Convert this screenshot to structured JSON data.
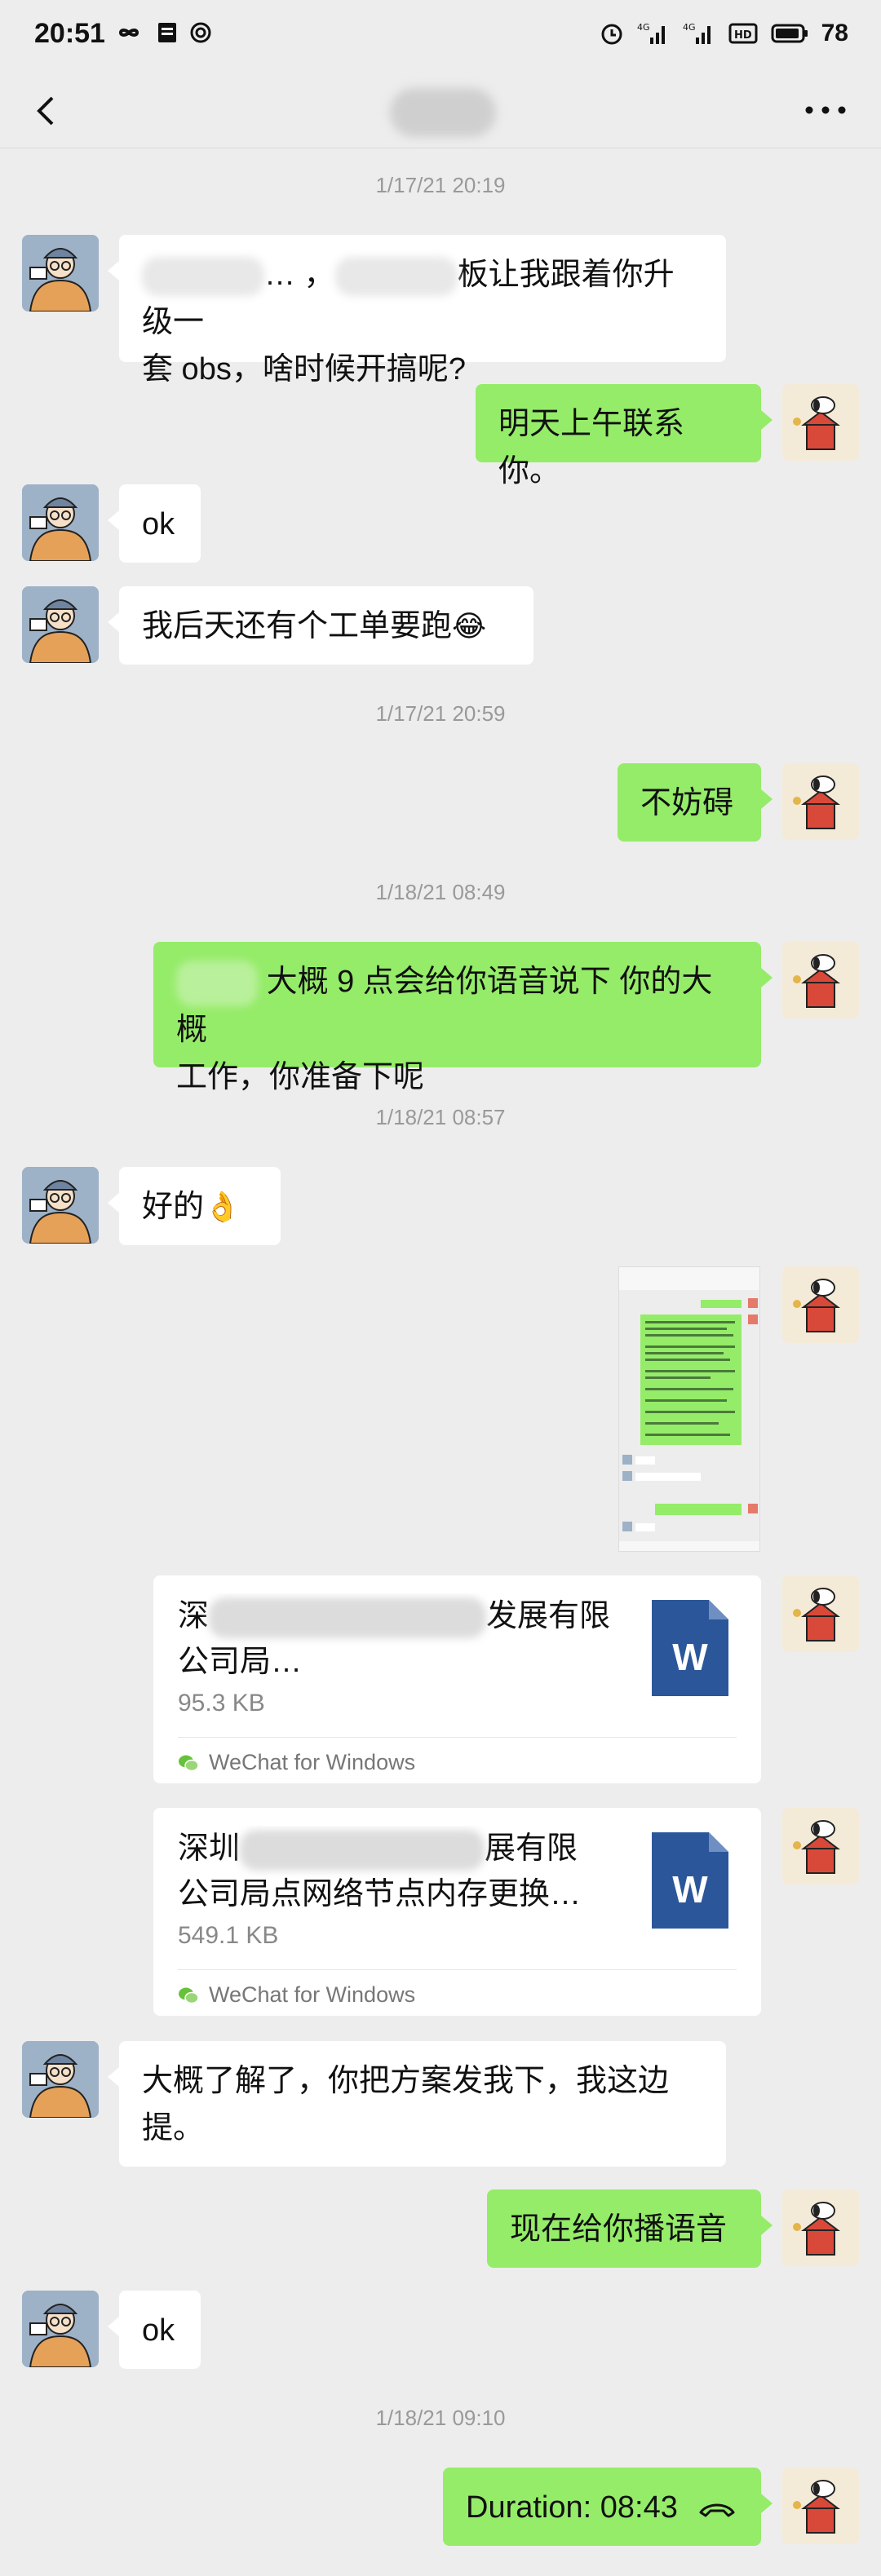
{
  "status_bar": {
    "time": "20:51",
    "battery": "78",
    "signal_label_1": "4G",
    "signal_label_2": "4G",
    "hd_label": "HD"
  },
  "chat": {
    "title": "",
    "timestamps": [
      "1/17/21 20:19",
      "1/17/21 20:59",
      "1/18/21 08:49",
      "1/18/21 08:57",
      "1/18/21 09:10"
    ],
    "messages": {
      "m1_a": "… ，",
      "m1_b": "板让我跟着你升级一",
      "m1_c": "套 obs，啥时候开搞呢?",
      "m2": "明天上午联系你。",
      "m3": "ok",
      "m4": "我后天还有个工单要跑",
      "m4_emoji": "😂",
      "m5": "不妨碍",
      "m6_a": "大概 9 点会给你语音说下 你的大概",
      "m6_b": "工作，你准备下呢",
      "m7": "好的",
      "m7_emoji": "👌",
      "m10_a": "大概了解了，你把方案发我下，我这边",
      "m10_b": "提。",
      "m11": "现在给你播语音",
      "m12": "ok",
      "m13": "Duration: 08:43"
    },
    "files": [
      {
        "name_a": "深",
        "name_b": "发展有限",
        "name_c": "公司局…",
        "size": "95.3 KB",
        "source": "WeChat for Windows",
        "icon_letter": "W"
      },
      {
        "name_a": "深圳",
        "name_b": "展有限",
        "name_c": "公司局点网络节点内存更换…",
        "size": "549.1 KB",
        "source": "WeChat for Windows",
        "icon_letter": "W"
      }
    ]
  },
  "colors": {
    "background": "#ededed",
    "bubble_self": "#95ec69",
    "bubble_other": "#ffffff",
    "word_blue": "#2b579a"
  },
  "icons": [
    "back-icon",
    "more-icon",
    "word-file-icon",
    "wechat-icon",
    "call-icon"
  ]
}
